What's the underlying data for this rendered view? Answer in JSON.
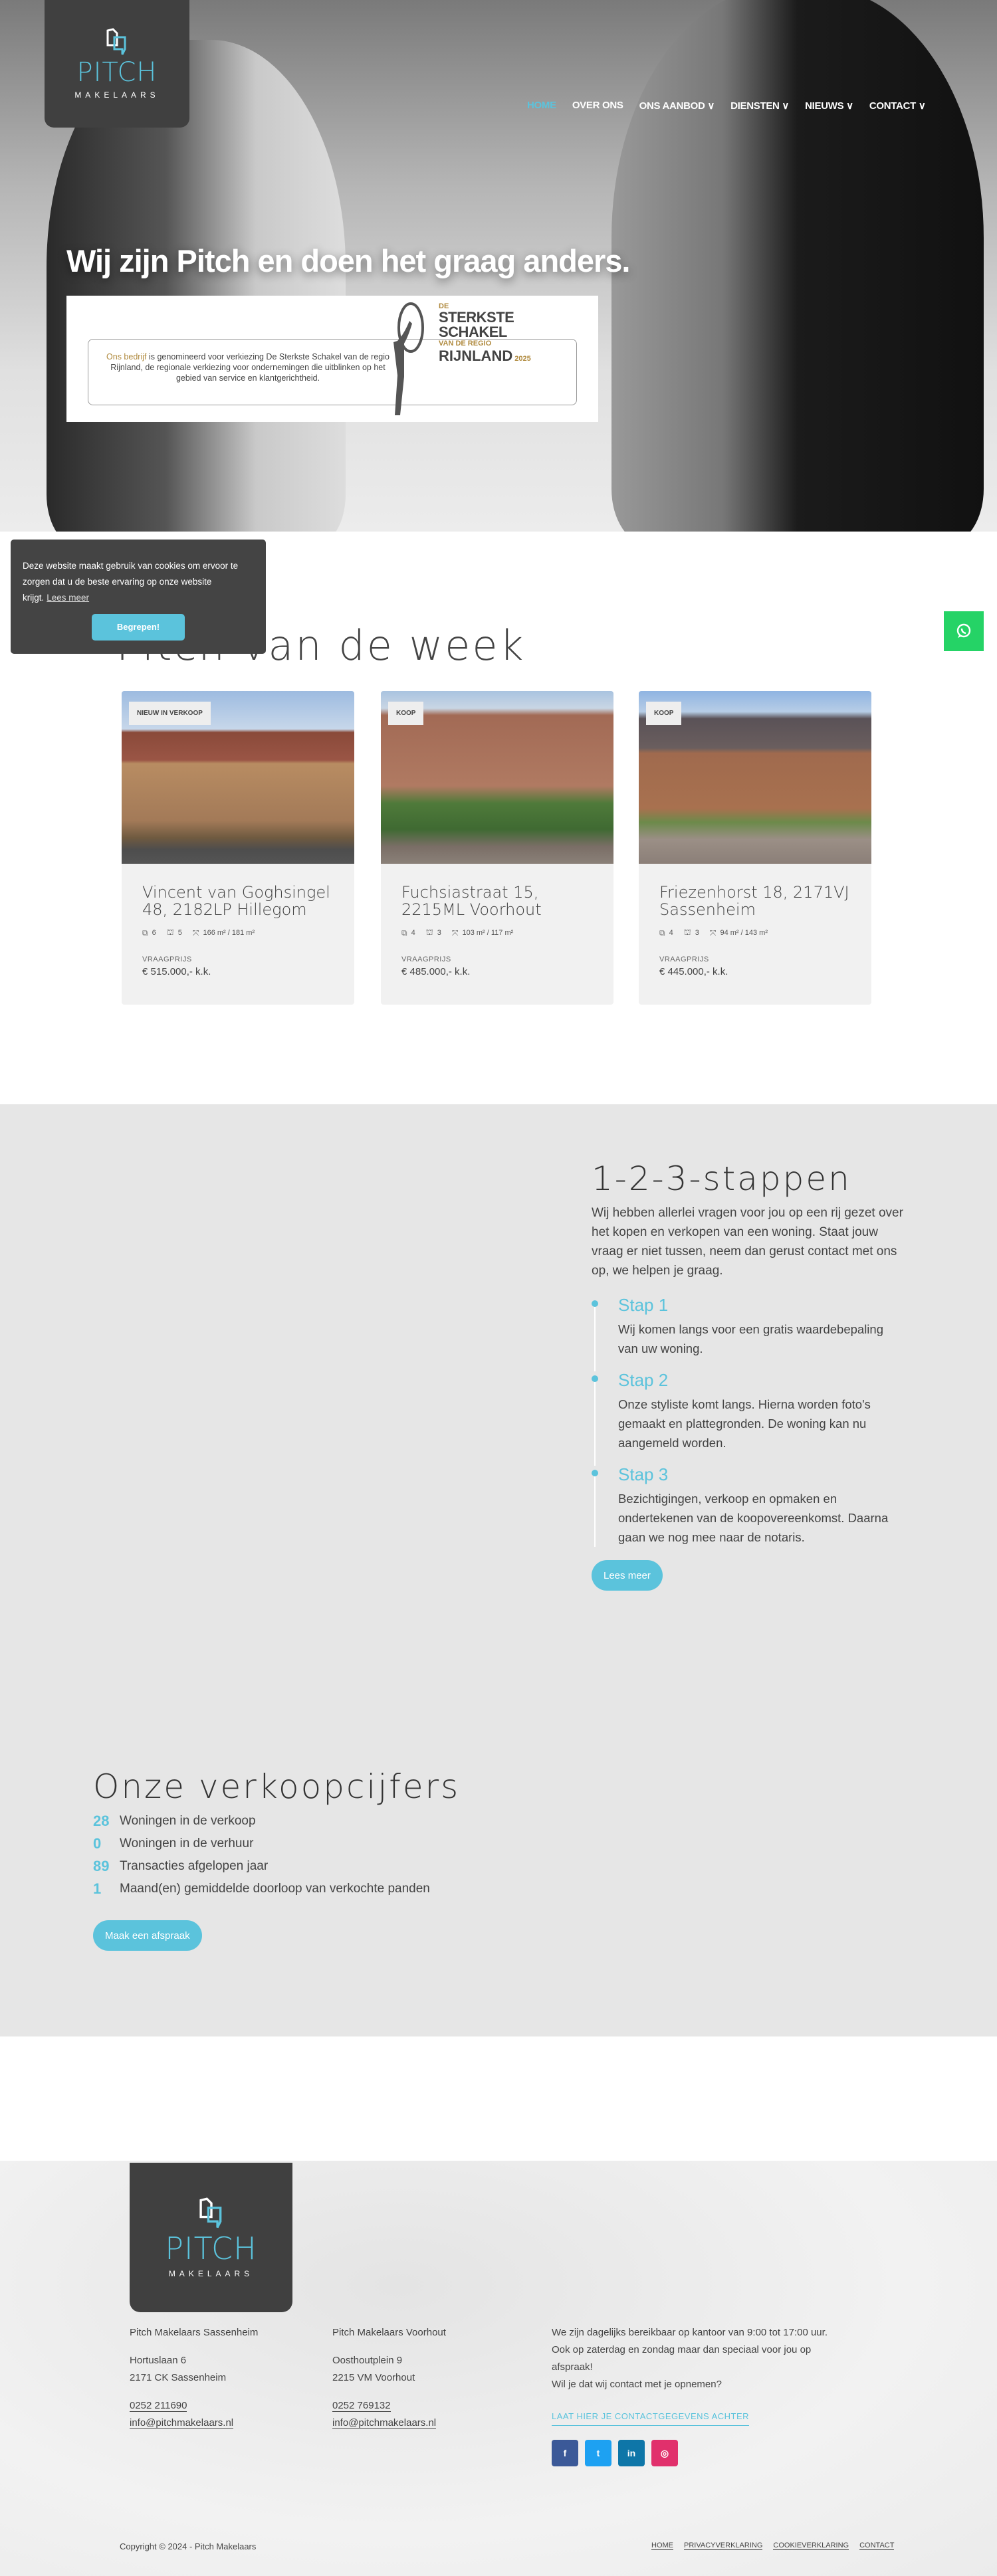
{
  "header": {
    "logo": {
      "word": "PITCH",
      "sub": "MAKELAARS"
    },
    "nav": [
      {
        "label": "HOME",
        "active": true
      },
      {
        "label": "OVER ONS"
      },
      {
        "label": "ONS AANBOD ∨"
      },
      {
        "label": "DIENSTEN ∨"
      },
      {
        "label": "NIEUWS ∨"
      },
      {
        "label": "CONTACT ∨"
      }
    ]
  },
  "hero": {
    "title": "Wij zijn Pitch en doen het graag anders.",
    "banner": {
      "highlight": "Ons bedrijf",
      "text": " is genomineerd voor verkiezing De Sterkste Schakel van de regio Rijnland, de regionale verkiezing voor ondernemingen die uitblinken op het gebied van service en klantgerichtheid.",
      "award_de": "DE",
      "award_main": "STERKSTE SCHAKEL",
      "award_region": "VAN DE REGIO",
      "award_place": "RIJNLAND",
      "award_year": "2025"
    }
  },
  "cookie": {
    "text": "Deze website maakt gebruik van cookies om ervoor te zorgen dat u de beste ervaring op onze website krijgt.",
    "link": "Lees meer",
    "button": "Begrepen!"
  },
  "week": {
    "title": "Pitch van de week",
    "cards": [
      {
        "badge": "NIEUW IN VERKOOP",
        "title": "Vincent van Goghsingel 48, 2182LP Hillegom",
        "rooms": "6",
        "bedrooms": "5",
        "area": "166 m² / 181 m²",
        "price_label": "VRAAGPRIJS",
        "price": "€ 515.000,- k.k."
      },
      {
        "badge": "KOOP",
        "title": "Fuchsiastraat 15, 2215ML Voorhout",
        "rooms": "4",
        "bedrooms": "3",
        "area": "103 m² / 117 m²",
        "price_label": "VRAAGPRIJS",
        "price": "€ 485.000,- k.k."
      },
      {
        "badge": "KOOP",
        "title": "Friezenhorst 18, 2171VJ Sassenheim",
        "rooms": "4",
        "bedrooms": "3",
        "area": "94 m² / 143 m²",
        "price_label": "VRAAGPRIJS",
        "price": "€ 445.000,- k.k."
      }
    ]
  },
  "steps": {
    "title": "1-2-3-stappen",
    "intro": "Wij hebben allerlei vragen voor jou op een rij gezet over het kopen en verkopen van een woning. Staat jouw vraag er niet tussen, neem dan gerust contact met ons op, we helpen je graag.",
    "items": [
      {
        "title": "Stap 1",
        "text": "Wij komen langs voor een gratis waardebepaling van uw woning."
      },
      {
        "title": "Stap 2",
        "text": "Onze styliste komt langs. Hierna worden foto's gemaakt en plattegronden. De woning kan nu aangemeld worden."
      },
      {
        "title": "Stap 3",
        "text": "Bezichtigingen, verkoop en opmaken en ondertekenen van de koopovereenkomst. Daarna gaan we nog mee naar de notaris."
      }
    ],
    "button": "Lees meer"
  },
  "stats": {
    "title": "Onze verkoopcijfers",
    "items": [
      {
        "value": "28",
        "label": "Woningen in de verkoop"
      },
      {
        "value": "0",
        "label": "Woningen in de verhuur"
      },
      {
        "value": "89",
        "label": "Transacties afgelopen jaar"
      },
      {
        "value": "1",
        "label": "Maand(en) gemiddelde doorloop van verkochte panden"
      }
    ],
    "button": "Maak een afspraak"
  },
  "footer": {
    "offices": [
      {
        "name": "Pitch Makelaars Sassenheim",
        "street": "Hortuslaan 6",
        "city": "2171 CK Sassenheim",
        "phone": "0252 211690",
        "email": "info@pitchmakelaars.nl"
      },
      {
        "name": "Pitch Makelaars Voorhout",
        "street": "Oosthoutplein 9",
        "city": "2215 VM Voorhout",
        "phone": "0252 769132",
        "email": "info@pitchmakelaars.nl"
      }
    ],
    "hours": "We zijn dagelijks bereikbaar op kantoor van 9:00 tot 17:00 uur.",
    "weekend": "Ook op zaterdag en zondag maar dan speciaal voor jou op afspraak!",
    "question": "Wil je dat wij contact met je opnemen?",
    "cta": "LAAT HIER JE CONTACTGEGEVENS ACHTER",
    "socials": [
      {
        "icon": "f",
        "name": "facebook",
        "color": "#3b5998"
      },
      {
        "icon": "t",
        "name": "twitter",
        "color": "#1da1f2"
      },
      {
        "icon": "in",
        "name": "linkedin",
        "color": "#0e76a8"
      },
      {
        "icon": "◎",
        "name": "instagram",
        "color": "#e1306c"
      }
    ],
    "copyright": "Copyright © 2024 - Pitch Makelaars",
    "links": [
      "HOME",
      "PRIVACYVERKLARING",
      "COOKIEVERKLARING",
      "CONTACT"
    ]
  },
  "colors": {
    "accent": "#5bc3dc",
    "dark": "#404040",
    "whatsapp": "#25d366"
  }
}
